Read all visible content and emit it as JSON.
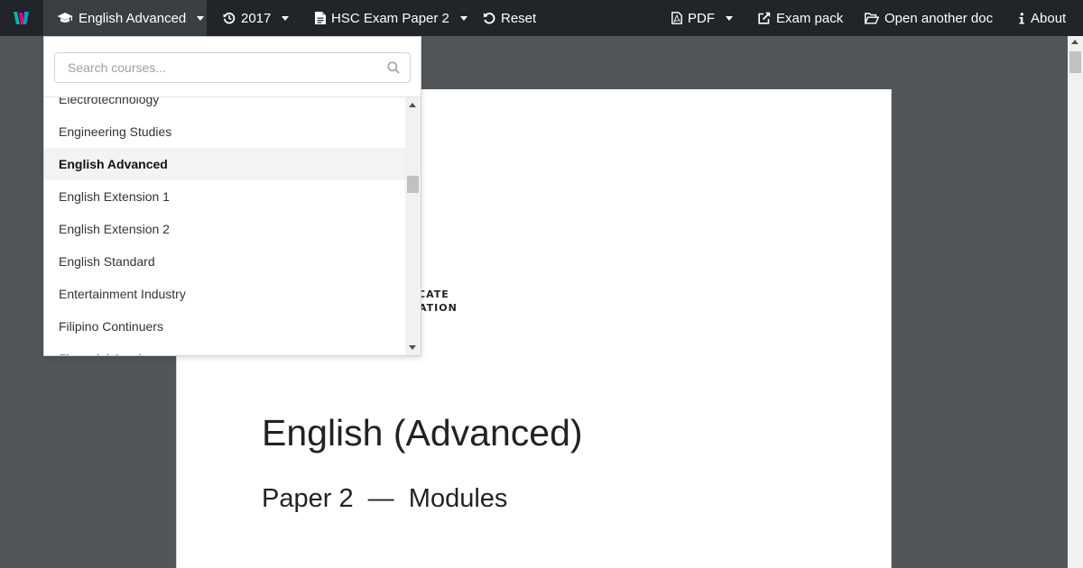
{
  "navbar": {
    "course": "English Advanced",
    "year": "2017",
    "paper": "HSC Exam Paper 2",
    "reset": "Reset",
    "pdf": "PDF",
    "exam_pack": "Exam pack",
    "open_doc": "Open another doc",
    "about": "About"
  },
  "course_dropdown": {
    "search_placeholder": "Search courses...",
    "items": [
      {
        "label": "Electrotechnology"
      },
      {
        "label": "Engineering Studies"
      },
      {
        "label": "English Advanced",
        "selected": true
      },
      {
        "label": "English Extension 1"
      },
      {
        "label": "English Extension 2"
      },
      {
        "label": "English Standard"
      },
      {
        "label": "Entertainment Industry"
      },
      {
        "label": "Filipino Continuers"
      },
      {
        "label": "Financial Services"
      }
    ]
  },
  "document": {
    "header_line1": "CATE",
    "header_line2": "ATION",
    "title": "English (Advanced)",
    "subtitle": "Paper 2  —  Modules"
  },
  "colors": {
    "navbar_bg": "#212529",
    "navbar_active_bg": "#3a3f44",
    "viewer_bg": "#525659",
    "logo_magenta": "#e6007e",
    "logo_teal": "#00b5ad"
  }
}
